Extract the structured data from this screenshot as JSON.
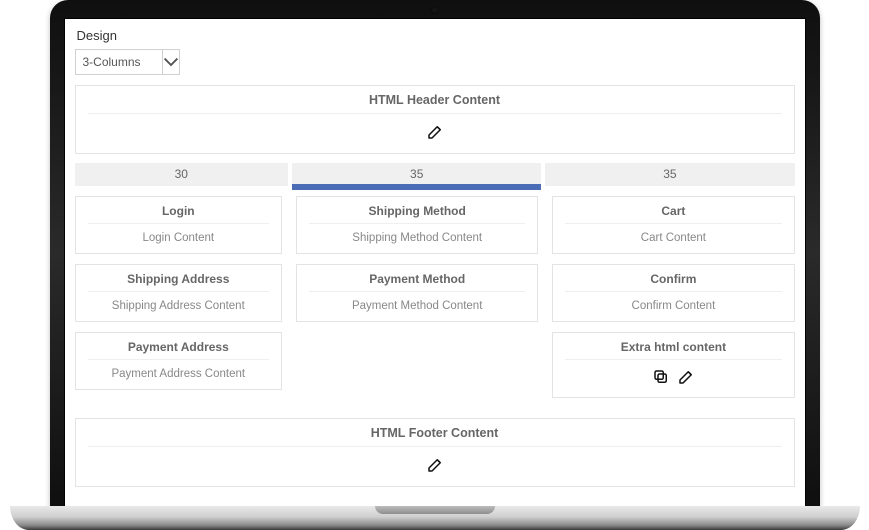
{
  "page_title": "Design",
  "layout_select": {
    "selected": "3-Columns"
  },
  "header_panel": {
    "title": "HTML Header Content"
  },
  "ruler": [
    {
      "value": "30",
      "active": false
    },
    {
      "value": "35",
      "active": true
    },
    {
      "value": "35",
      "active": false
    }
  ],
  "columns": [
    [
      {
        "title": "Login",
        "body": "Login Content"
      },
      {
        "title": "Shipping Address",
        "body": "Shipping Address Content"
      },
      {
        "title": "Payment Address",
        "body": "Payment Address Content"
      }
    ],
    [
      {
        "title": "Shipping Method",
        "body": "Shipping Method Content"
      },
      {
        "title": "Payment Method",
        "body": "Payment Method Content"
      }
    ],
    [
      {
        "title": "Cart",
        "body": "Cart Content"
      },
      {
        "title": "Confirm",
        "body": "Confirm Content"
      },
      {
        "title": "Extra html content",
        "body": null,
        "has_copy": true,
        "has_edit": true
      }
    ]
  ],
  "footer_panel": {
    "title": "HTML Footer Content"
  }
}
